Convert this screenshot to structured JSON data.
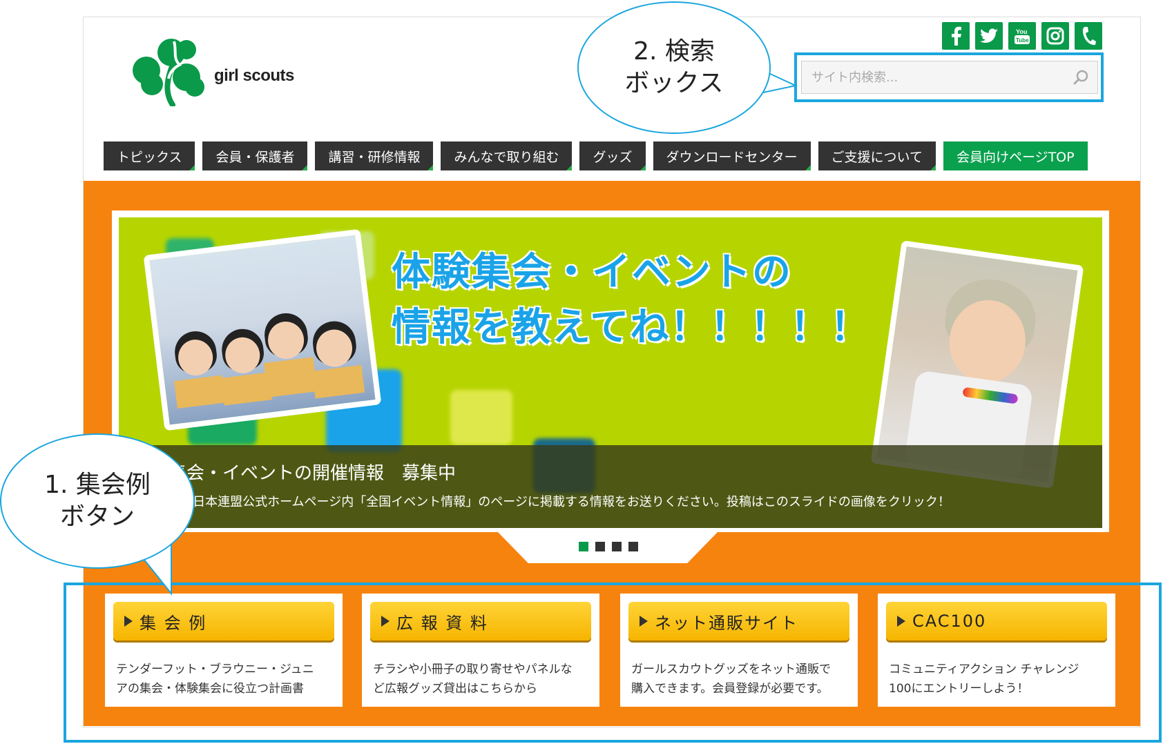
{
  "logo": {
    "text": "girl scouts",
    "icon": "clover-icon",
    "color": "#0a9a4a"
  },
  "social": [
    "facebook-icon",
    "twitter-icon",
    "youtube-icon",
    "instagram-icon",
    "phone-icon"
  ],
  "search": {
    "placeholder": "サイト内検索..."
  },
  "nav": {
    "items": [
      "トピックス",
      "会員・保護者",
      "講習・研修情報",
      "みんなで取り組む",
      "グッズ",
      "ダウンロードセンター",
      "ご支援について",
      "会員向けページTOP"
    ]
  },
  "slider": {
    "title_line1": "体験集会・イベントの",
    "title_line2": "情報を教えてね！！！！！",
    "caption_title": "集会・イベントの開催情報　募集中",
    "caption_text": "て、日本連盟公式ホームページ内「全国イベント情報」のページに掲載する情報をお送りください。投稿はこのスライドの画像をクリック！",
    "dots_total": 4,
    "active_dot": 1
  },
  "cards": [
    {
      "label": "集 会 例",
      "desc_line1": "テンダーフット・ブラウニー・ジュニ",
      "desc_line2": "アの集会・体験集会に役立つ計画書"
    },
    {
      "label": "広 報 資 料",
      "desc_line1": "チラシや小冊子の取り寄せやパネルな",
      "desc_line2": "ど広報グッズ貸出はこちらから"
    },
    {
      "label": "ネット通販サイト",
      "desc_line1": "ガールスカウトグッズをネット通販で",
      "desc_line2": "購入できます。会員登録が必要です。"
    },
    {
      "label": "CAC100",
      "desc_line1": "コミュニティアクション チャレンジ",
      "desc_line2": "100にエントリーしよう！"
    }
  ],
  "annotations": {
    "search": {
      "line1": "2. 検索",
      "line2": "ボックス"
    },
    "cards": {
      "line1": "1. 集会例",
      "line2": "ボタン"
    },
    "color": "#1aa6de"
  },
  "colors": {
    "brand_green": "#0a9a4a",
    "orange": "#f7830f",
    "nav_dark": "#333333",
    "slide_bg": "#b6d500",
    "button_yellow": "#f6b400"
  }
}
